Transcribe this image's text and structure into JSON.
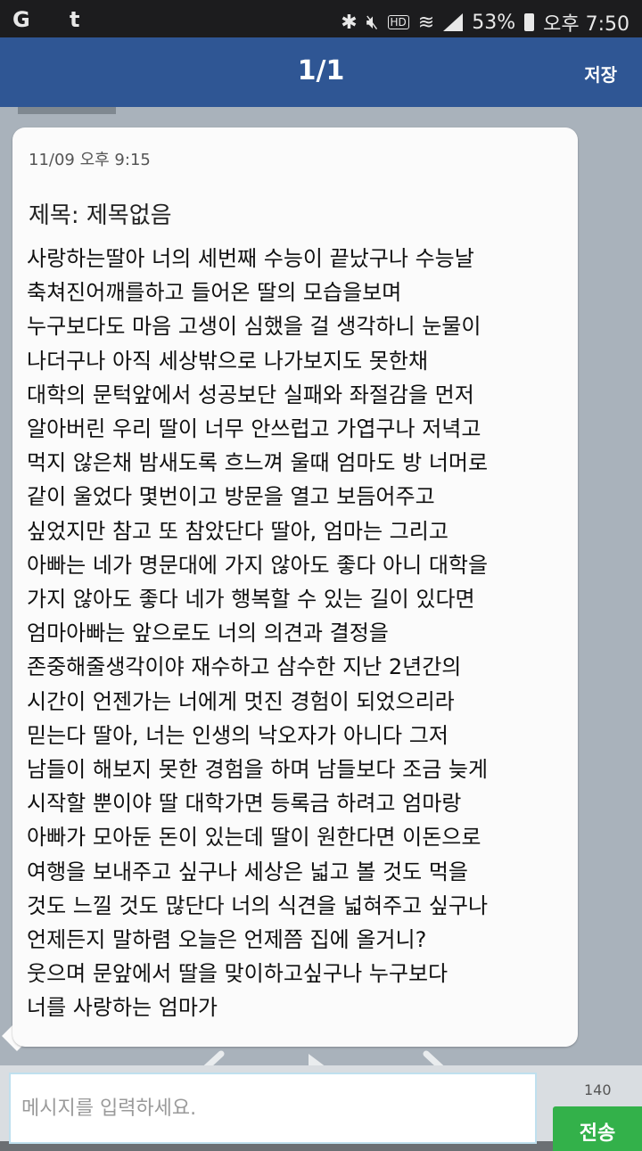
{
  "status_bar": {
    "left_icons": [
      "whatsapp-icon",
      "tumblr-icon"
    ],
    "left_text": "G t",
    "right_icons": [
      "bluetooth-icon",
      "mute-icon",
      "hd-icon",
      "wifi-icon",
      "signal-icon",
      "battery-icon"
    ],
    "hd_label": "HD",
    "battery_percent": "53%",
    "time": "오후 7:50"
  },
  "header": {
    "page_indicator": "1/1",
    "save_label": "저장"
  },
  "message": {
    "timestamp": "11/09 오후 9:15",
    "subject": "제목: 제목없음",
    "body_lines": [
      "사랑하는딸아 너의 세번째 수능이 끝났구나 수능날",
      "축쳐진어깨를하고 들어온 딸의 모습을보며",
      "누구보다도 마음 고생이 심했을 걸 생각하니 눈물이",
      "나더구나 아직 세상밖으로 나가보지도 못한채",
      "대학의 문턱앞에서 성공보단 실패와 좌절감을 먼저",
      "알아버린 우리 딸이 너무 안쓰럽고 가엽구나 저녁고",
      "먹지 않은채 밤새도록 흐느껴 울때 엄마도 방 너머로",
      "같이 울었다 몇번이고 방문을 열고 보듬어주고",
      "싶었지만 참고 또 참았단다 딸아, 엄마는 그리고",
      "아빠는 네가 명문대에 가지 않아도 좋다 아니 대학을",
      "가지 않아도 좋다 네가 행복할 수 있는 길이 있다면",
      "엄마아빠는 앞으로도 너의 의견과 결정을",
      "존중해줄생각이야 재수하고 삼수한 지난 2년간의",
      "시간이 언젠가는 너에게 멋진 경험이 되었으리라",
      "믿는다 딸아, 너는 인생의 낙오자가 아니다 그저",
      "남들이 해보지 못한 경험을 하며 남들보다 조금 늦게",
      "시작할 뿐이야 딸 대학가면 등록금 하려고 엄마랑",
      "아빠가 모아둔 돈이 있는데 딸이 원한다면 이돈으로",
      "여행을 보내주고 싶구나 세상은 넓고 볼 것도 먹을",
      "것도 느낄 것도 많단다 너의 식견을 넓혀주고 싶구나",
      "언제든지 말하렴 오늘은 언제쯤 집에 올거니?",
      "웃으며 문앞에서 딸을 맞이하고싶구나 누구보다",
      "너를 사랑하는 엄마가"
    ]
  },
  "navigation": {
    "icons": [
      "previous-arrow-icon",
      "play-icon",
      "next-arrow-icon"
    ]
  },
  "composer": {
    "placeholder": "메시지를 입력하세요.",
    "char_count": "140",
    "send_label": "전송"
  },
  "colors": {
    "header_bg": "#2f5694",
    "status_bg": "#1c1c1e",
    "send_green": "#33b14a",
    "content_bg": "#a9b2bb"
  }
}
